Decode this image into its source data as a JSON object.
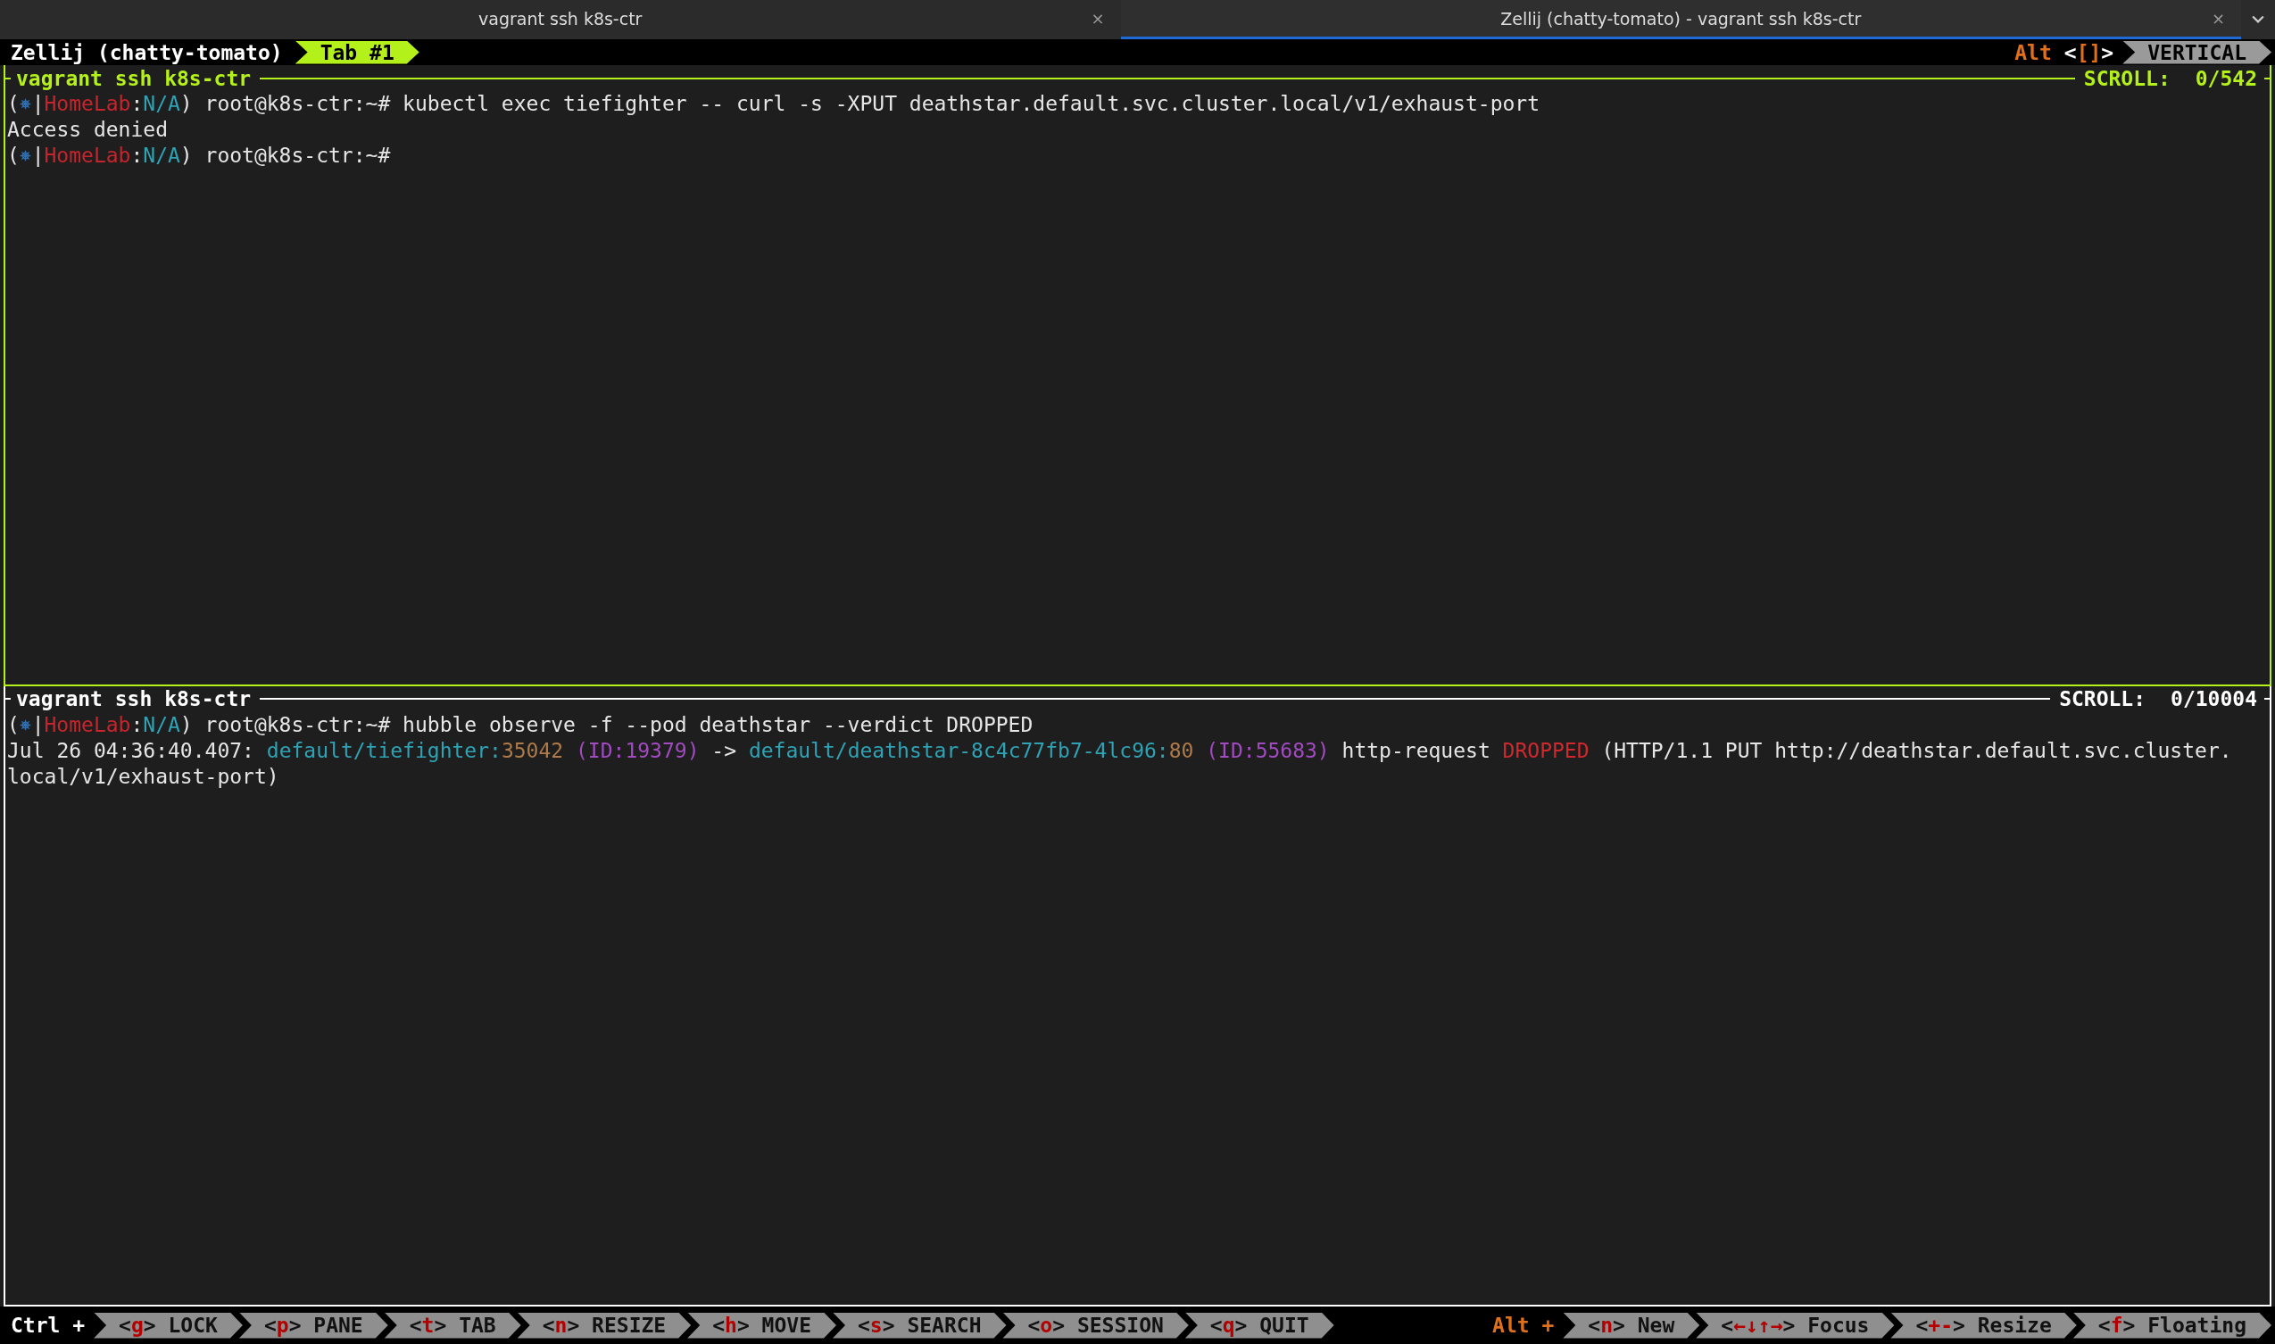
{
  "window_tabs": [
    {
      "title": "vagrant ssh k8s-ctr",
      "close": "×",
      "selected": false
    },
    {
      "title": "Zellij (chatty-tomato) - vagrant ssh k8s-ctr",
      "close": "×",
      "selected": true
    }
  ],
  "top_bar": {
    "session": "Zellij (chatty-tomato)",
    "tabs": [
      {
        "label": "Tab #1",
        "selected": true
      }
    ],
    "modifier": "Alt",
    "bracket_open": "<",
    "swap_keys": "[]",
    "bracket_close": ">",
    "layout": "VERTICAL"
  },
  "panes": [
    {
      "title": "vagrant ssh k8s-ctr",
      "focused": true,
      "scroll_label": "SCROLL:",
      "scroll_value": "0/542",
      "lines": [
        [
          {
            "kind": "text",
            "text": "(",
            "color": "#e6e6e6"
          },
          {
            "kind": "icon",
            "color": "#2f6fb3"
          },
          {
            "kind": "text",
            "text": "|",
            "color": "#e6e6e6"
          },
          {
            "kind": "text",
            "text": "HomeLab",
            "color": "#c8242b"
          },
          {
            "kind": "text",
            "text": ":",
            "color": "#e6e6e6"
          },
          {
            "kind": "text",
            "text": "N/A",
            "color": "#2ea3b5"
          },
          {
            "kind": "text",
            "text": ") root@k8s-ctr:~# kubectl exec tiefighter -- curl -s -XPUT deathstar.default.svc.cluster.local/v1/exhaust-port",
            "color": "#e6e6e6"
          }
        ],
        [
          {
            "kind": "text",
            "text": "Access denied",
            "color": "#e6e6e6"
          }
        ],
        [
          {
            "kind": "text",
            "text": "(",
            "color": "#e6e6e6"
          },
          {
            "kind": "icon",
            "color": "#2f6fb3"
          },
          {
            "kind": "text",
            "text": "|",
            "color": "#e6e6e6"
          },
          {
            "kind": "text",
            "text": "HomeLab",
            "color": "#c8242b"
          },
          {
            "kind": "text",
            "text": ":",
            "color": "#e6e6e6"
          },
          {
            "kind": "text",
            "text": "N/A",
            "color": "#2ea3b5"
          },
          {
            "kind": "text",
            "text": ") root@k8s-ctr:~#",
            "color": "#e6e6e6"
          }
        ]
      ]
    },
    {
      "title": "vagrant ssh k8s-ctr",
      "focused": false,
      "scroll_label": "SCROLL:",
      "scroll_value": "0/10004",
      "lines": [
        [
          {
            "kind": "text",
            "text": "(",
            "color": "#e6e6e6"
          },
          {
            "kind": "icon",
            "color": "#2f6fb3"
          },
          {
            "kind": "text",
            "text": "|",
            "color": "#e6e6e6"
          },
          {
            "kind": "text",
            "text": "HomeLab",
            "color": "#c8242b"
          },
          {
            "kind": "text",
            "text": ":",
            "color": "#e6e6e6"
          },
          {
            "kind": "text",
            "text": "N/A",
            "color": "#2ea3b5"
          },
          {
            "kind": "text",
            "text": ") root@k8s-ctr:~# hubble observe -f --pod deathstar --verdict DROPPED",
            "color": "#e6e6e6"
          }
        ],
        [
          {
            "kind": "text",
            "text": "Jul 26 04:36:40.407: ",
            "color": "#e6e6e6"
          },
          {
            "kind": "text",
            "text": "default/tiefighter:",
            "color": "#2ea3b5"
          },
          {
            "kind": "text",
            "text": "35042",
            "color": "#b07a48"
          },
          {
            "kind": "text",
            "text": " (ID:19379)",
            "color": "#a24ac2"
          },
          {
            "kind": "text",
            "text": " -> ",
            "color": "#e6e6e6"
          },
          {
            "kind": "text",
            "text": "default/deathstar-8c4c77fb7-4lc96:",
            "color": "#2ea3b5"
          },
          {
            "kind": "text",
            "text": "80",
            "color": "#b07a48"
          },
          {
            "kind": "text",
            "text": " (ID:55683)",
            "color": "#a24ac2"
          },
          {
            "kind": "text",
            "text": " http-request ",
            "color": "#e6e6e6"
          },
          {
            "kind": "text",
            "text": "DROPPED",
            "color": "#d0282c"
          },
          {
            "kind": "text",
            "text": " (HTTP/1.1 PUT http://deathstar.default.svc.cluster.",
            "color": "#e6e6e6"
          }
        ],
        [
          {
            "kind": "text",
            "text": "local/v1/exhaust-port)",
            "color": "#e6e6e6"
          }
        ]
      ]
    }
  ],
  "bottom_bar": {
    "ctrl_label": "Ctrl +",
    "bracket_open": "<",
    "bracket_close": ">",
    "ctrl_keys": [
      {
        "key": "g",
        "label": "LOCK"
      },
      {
        "key": "p",
        "label": "PANE"
      },
      {
        "key": "t",
        "label": "TAB"
      },
      {
        "key": "n",
        "label": "RESIZE"
      },
      {
        "key": "h",
        "label": "MOVE"
      },
      {
        "key": "s",
        "label": "SEARCH"
      },
      {
        "key": "o",
        "label": "SESSION"
      },
      {
        "key": "q",
        "label": "QUIT"
      }
    ],
    "alt_label": "Alt +",
    "alt_keys": [
      {
        "key": "n",
        "label": "New"
      },
      {
        "key": "←↓↑→",
        "label": "Focus"
      },
      {
        "key": "+-",
        "label": "Resize"
      },
      {
        "key": "f",
        "label": "Floating"
      }
    ]
  }
}
